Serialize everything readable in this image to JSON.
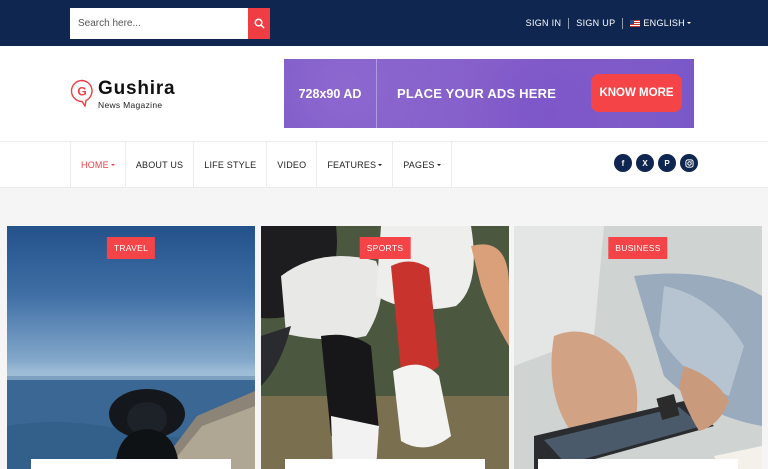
{
  "topbar": {
    "search_placeholder": "Search here...",
    "sign_in": "SIGN IN",
    "sign_up": "SIGN UP",
    "language": "ENGLISH"
  },
  "logo": {
    "letter": "G",
    "title": "Gushira",
    "subtitle": "News Magazine"
  },
  "ad": {
    "size": "728x90 AD",
    "text": "PLACE YOUR ADS HERE",
    "button": "KNOW MORE"
  },
  "nav": {
    "items": [
      {
        "label": "HOME",
        "dropdown": true,
        "active": true
      },
      {
        "label": "ABOUT US"
      },
      {
        "label": "LIFE STYLE"
      },
      {
        "label": "VIDEO"
      },
      {
        "label": "FEATURES",
        "dropdown": true
      },
      {
        "label": "PAGES",
        "dropdown": true
      }
    ]
  },
  "social": {
    "facebook": "f",
    "x": "X",
    "pinterest": "P",
    "instagram": "instagram-icon"
  },
  "cards": [
    {
      "category": "TRAVEL"
    },
    {
      "category": "SPORTS"
    },
    {
      "category": "BUSINESS"
    }
  ],
  "colors": {
    "primary": "#0f2650",
    "accent": "#f44447"
  }
}
